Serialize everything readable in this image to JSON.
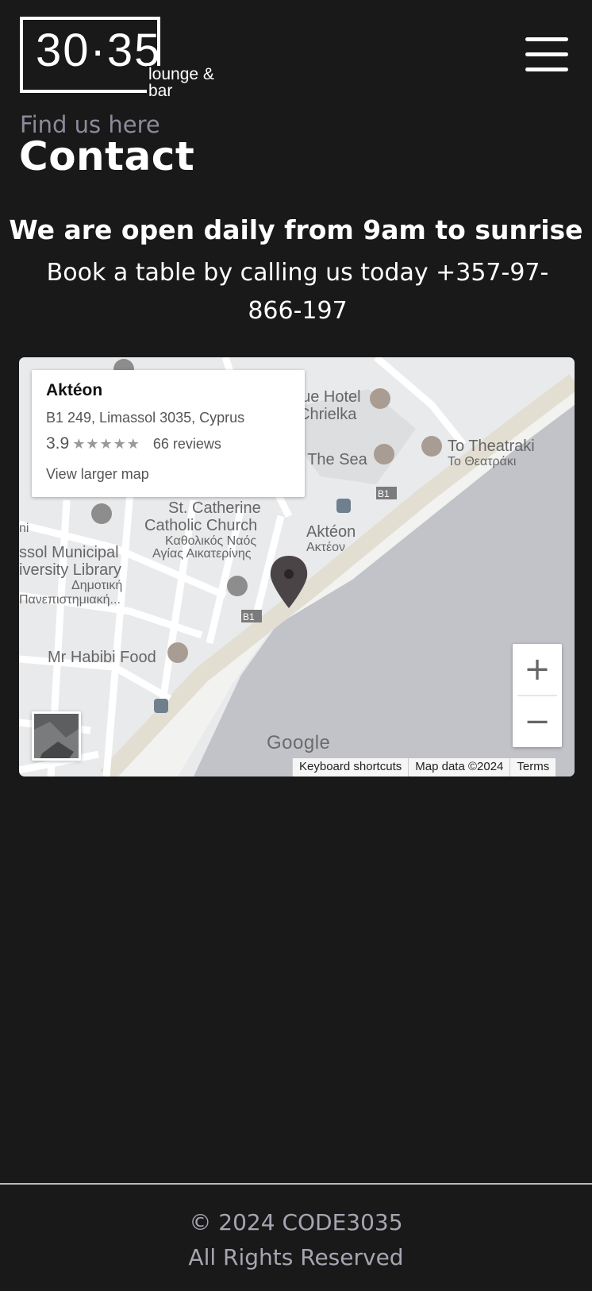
{
  "header": {
    "logo_number": "30·35",
    "logo_sub": "lounge & bar"
  },
  "page": {
    "subtitle": "Find us here",
    "title": "Contact",
    "hours": "We are open daily from 9am to sunrise",
    "book": "Book a table by calling us today +357-97-866-197"
  },
  "map": {
    "place_name": "Aktéon",
    "address": "B1 249, Limassol 3035, Cyprus",
    "rating": "3.9",
    "stars": "★★★★★",
    "reviews": "66 reviews",
    "larger_map": "View larger map",
    "zoom_in": "+",
    "zoom_out": "−",
    "google": "Google",
    "keyboard_shortcuts": "Keyboard shortcuts",
    "map_data": "Map data ©2024",
    "terms": "Terms",
    "labels": {
      "hotel_1": "que Hotel",
      "hotel_2": "Chrielka",
      "the_sea": "y The Sea",
      "theatraki_1": "To Theatraki",
      "theatraki_2": "Το Θεατράκι",
      "church_1": "St. Catherine",
      "church_2": "Catholic Church",
      "church_3": "Καθολικός Ναός",
      "church_4": "Αγίας Αικατερίνης",
      "library_1": "ssol Municipal",
      "library_2": "iversity Library",
      "library_3": "Δημοτική",
      "library_4": "Πανεπιστημιακή...",
      "akteon_1": "Aktéon",
      "akteon_2": "Ακτέον",
      "habibi": "Mr Habibi Food",
      "road_b1_a": "B1",
      "road_b1_b": "B1",
      "ni": "ni"
    },
    "colors": {
      "sea": "#c1c3c8",
      "land": "#e9eaec",
      "road": "#ffffff",
      "pin": "#4b4446"
    }
  },
  "footer": {
    "copyright": "© 2024 CODE3035",
    "rights": "All Rights Reserved"
  }
}
